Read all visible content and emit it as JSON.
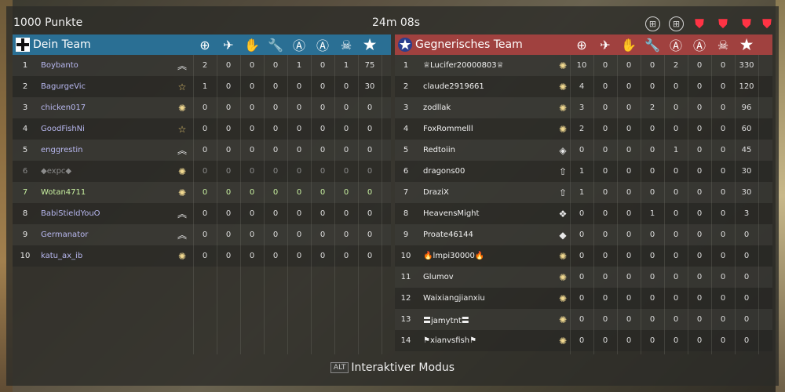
{
  "top": {
    "points": "1000 Punkte",
    "timer": "24m 08s",
    "capture_points": [
      "round",
      "round",
      "shield",
      "shield",
      "shield",
      "shield"
    ]
  },
  "own_team": {
    "title": "Dein Team",
    "flag_icon": "iron-cross-icon",
    "rows": [
      {
        "num": "1",
        "name": "Boybanto",
        "rank": "chevron-rank-icon",
        "stats": [
          "2",
          "0",
          "0",
          "0",
          "1",
          "0",
          "1",
          "75"
        ]
      },
      {
        "num": "2",
        "name": "BagurgeVic",
        "rank": "star-rank-icon",
        "stats": [
          "1",
          "0",
          "0",
          "0",
          "0",
          "0",
          "0",
          "30"
        ]
      },
      {
        "num": "3",
        "name": "chicken017",
        "rank": "sun-rank-icon",
        "stats": [
          "0",
          "0",
          "0",
          "0",
          "0",
          "0",
          "0",
          "0"
        ]
      },
      {
        "num": "4",
        "name": "GoodFishNi",
        "rank": "star-rank-icon",
        "stats": [
          "0",
          "0",
          "0",
          "0",
          "0",
          "0",
          "0",
          "0"
        ]
      },
      {
        "num": "5",
        "name": "enggrestin",
        "rank": "chevron-rank-icon",
        "stats": [
          "0",
          "0",
          "0",
          "0",
          "0",
          "0",
          "0",
          "0"
        ]
      },
      {
        "num": "6",
        "name": "◆expc◆",
        "rank": "sun-rank-icon",
        "stats": [
          "0",
          "0",
          "0",
          "0",
          "0",
          "0",
          "0",
          "0"
        ],
        "state": "dim"
      },
      {
        "num": "7",
        "name": "Wotan4711",
        "rank": "sun-rank-icon",
        "stats": [
          "0",
          "0",
          "0",
          "0",
          "0",
          "0",
          "0",
          "0"
        ],
        "state": "self"
      },
      {
        "num": "8",
        "name": "BabiStieldYouO",
        "rank": "chevron-rank-icon",
        "stats": [
          "0",
          "0",
          "0",
          "0",
          "0",
          "0",
          "0",
          "0"
        ]
      },
      {
        "num": "9",
        "name": "Germanator",
        "rank": "chevron-rank-icon",
        "stats": [
          "0",
          "0",
          "0",
          "0",
          "0",
          "0",
          "0",
          "0"
        ]
      },
      {
        "num": "10",
        "name": "katu_ax_ib",
        "rank": "sun-rank-icon",
        "stats": [
          "0",
          "0",
          "0",
          "0",
          "0",
          "0",
          "0",
          "0"
        ]
      }
    ]
  },
  "enemy_team": {
    "title": "Gegnerisches Team",
    "flag_icon": "star-roundel-icon",
    "rows": [
      {
        "num": "1",
        "name": "♕Lucifer20000803♕",
        "rank": "sun-rank-icon",
        "stats": [
          "10",
          "0",
          "0",
          "0",
          "2",
          "0",
          "0",
          "330"
        ]
      },
      {
        "num": "2",
        "name": "claude2919661",
        "rank": "sun-rank-icon",
        "stats": [
          "4",
          "0",
          "0",
          "0",
          "0",
          "0",
          "0",
          "120"
        ]
      },
      {
        "num": "3",
        "name": "zodllak",
        "rank": "sun-rank-icon",
        "stats": [
          "3",
          "0",
          "0",
          "2",
          "0",
          "0",
          "0",
          "96"
        ]
      },
      {
        "num": "4",
        "name": "FoxRommelll",
        "rank": "sun-rank-icon",
        "stats": [
          "2",
          "0",
          "0",
          "0",
          "0",
          "0",
          "0",
          "60"
        ]
      },
      {
        "num": "5",
        "name": "Redtoiin",
        "rank": "diamond-rank-icon",
        "stats": [
          "0",
          "0",
          "0",
          "0",
          "1",
          "0",
          "0",
          "45"
        ]
      },
      {
        "num": "6",
        "name": "dragons00",
        "rank": "arrow-rank-icon",
        "stats": [
          "1",
          "0",
          "0",
          "0",
          "0",
          "0",
          "0",
          "30"
        ]
      },
      {
        "num": "7",
        "name": "DraziX",
        "rank": "arrow-rank-icon",
        "stats": [
          "1",
          "0",
          "0",
          "0",
          "0",
          "0",
          "0",
          "30"
        ]
      },
      {
        "num": "8",
        "name": "HeavensMight",
        "rank": "cluster-rank-icon",
        "stats": [
          "0",
          "0",
          "0",
          "1",
          "0",
          "0",
          "0",
          "3"
        ]
      },
      {
        "num": "9",
        "name": "Proate46144",
        "rank": "dot-rank-icon",
        "stats": [
          "0",
          "0",
          "0",
          "0",
          "0",
          "0",
          "0",
          "0"
        ]
      },
      {
        "num": "10",
        "name": "🔥lmpi30000🔥",
        "rank": "sun-rank-icon",
        "stats": [
          "0",
          "0",
          "0",
          "0",
          "0",
          "0",
          "0",
          "0"
        ]
      },
      {
        "num": "11",
        "name": "Glumov",
        "rank": "sun-rank-icon",
        "stats": [
          "0",
          "0",
          "0",
          "0",
          "0",
          "0",
          "0",
          "0"
        ]
      },
      {
        "num": "12",
        "name": "Waixiangjianxiu",
        "rank": "sun-rank-icon",
        "stats": [
          "0",
          "0",
          "0",
          "0",
          "0",
          "0",
          "0",
          "0"
        ]
      },
      {
        "num": "13",
        "name": "〓jamytnt〓",
        "rank": "sun-rank-icon",
        "stats": [
          "0",
          "0",
          "0",
          "0",
          "0",
          "0",
          "0",
          "0"
        ]
      },
      {
        "num": "14",
        "name": "⚑xianvsfish⚑",
        "rank": "sun-rank-icon",
        "stats": [
          "0",
          "0",
          "0",
          "0",
          "0",
          "0",
          "0",
          "0"
        ]
      }
    ]
  },
  "columns": [
    {
      "icon": "crosshair-icon",
      "glyph": "⊕"
    },
    {
      "icon": "plane-icon",
      "glyph": "✈"
    },
    {
      "icon": "hand-icon",
      "glyph": "✋"
    },
    {
      "icon": "wrench-icon",
      "glyph": "🔧"
    },
    {
      "icon": "capture-shield-icon",
      "glyph": "Ⓐ"
    },
    {
      "icon": "assist-icon",
      "glyph": "Ⓐ"
    },
    {
      "icon": "skull-icon",
      "glyph": "☠"
    },
    {
      "icon": "star-icon",
      "glyph": "★"
    }
  ],
  "footer": {
    "key": "ALT",
    "label": "Interaktiver Modus"
  },
  "colors": {
    "own_header": "#2a6f94",
    "enemy_header": "#a0413f",
    "own_name": "#b8b8f0",
    "self_highlight": "#c8f0a0",
    "capture_shield": "#ff3344"
  }
}
